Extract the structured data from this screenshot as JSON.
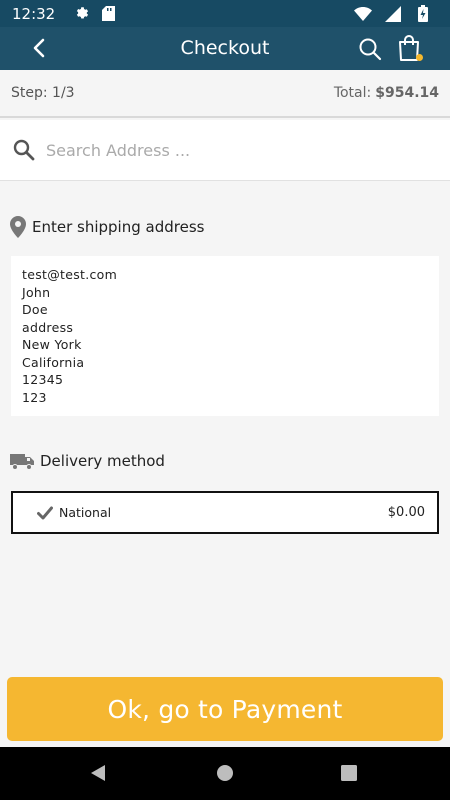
{
  "status_bar": {
    "time": "12:32",
    "icons": [
      "gear-icon",
      "sd-card-icon",
      "wifi-icon",
      "signal-icon",
      "battery-icon"
    ]
  },
  "app_bar": {
    "title": "Checkout",
    "left_icon": "back-arrow-icon",
    "right_icons": [
      "search-icon",
      "shopping-bag-icon"
    ],
    "accent_color": "#1f516a",
    "cart_badge_color": "#f5b82e"
  },
  "step": {
    "label": "Step: 1/3",
    "total_label": "Total:",
    "total_value": "$954.14"
  },
  "search": {
    "placeholder": "Search Address ...",
    "value": ""
  },
  "shipping": {
    "title": "Enter shipping address",
    "icon": "map-pin-icon",
    "lines": [
      "test@test.com",
      "John",
      "Doe",
      "address",
      "New York",
      "California",
      "12345",
      "123"
    ]
  },
  "delivery": {
    "title": "Delivery method",
    "icon": "truck-icon",
    "options": [
      {
        "name": "National",
        "price": "$0.00",
        "selected": true
      }
    ]
  },
  "actions": {
    "pay_label": "Ok, go to Payment",
    "pay_color": "#f5b731"
  },
  "nav_bar": {
    "buttons": [
      "back-triangle-icon",
      "home-circle-icon",
      "recents-square-icon"
    ]
  }
}
